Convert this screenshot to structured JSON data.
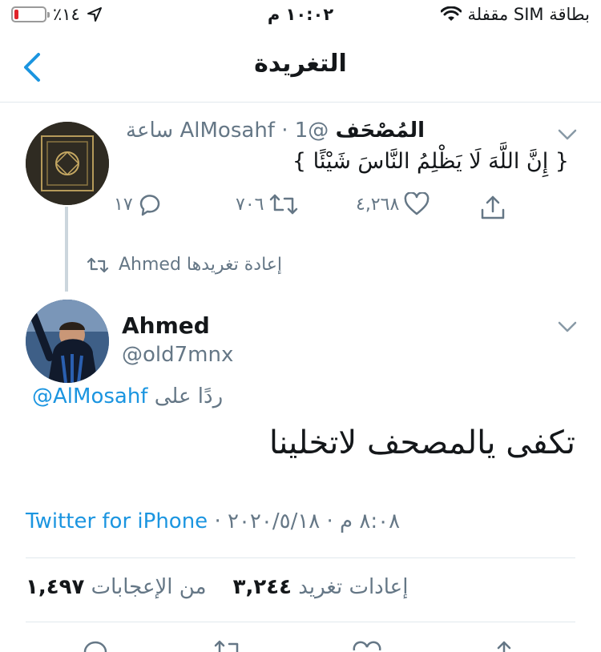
{
  "status_bar": {
    "carrier": "بطاقة SIM مقفلة",
    "time": "١٠:٠٢ م",
    "battery": "٪١٤",
    "battery_level": 0.14
  },
  "nav": {
    "title": "التغريدة"
  },
  "tweet1": {
    "name": "المُصْحَف",
    "handle": "@AlMosahf",
    "time": "· 1 ساعة",
    "text": "{ إِنَّ اللَّهَ لَا يَظْلِمُ النَّاسَ شَيْئًا }",
    "replies": "١٧",
    "retweets": "٧٠٦",
    "likes": "٤,٢٦٨"
  },
  "retweeted_by": "Ahmed إعادة تغريدها",
  "main_tweet": {
    "name": "Ahmed",
    "handle": "@old7mnx",
    "reply_label": "ردًا على",
    "reply_handle": "@AlMosahf",
    "text": "تكفى يالمصحف لاتخلينا",
    "timestamp": "٨:٠٨ م · ٢٠٢٠/٥/١٨ ·",
    "source": "Twitter for iPhone",
    "likes_count": "١,٤٩٧",
    "likes_label": "من الإعجابات",
    "retweets_count": "٣,٢٤٤",
    "retweets_label": "إعادات تغريد"
  },
  "colors": {
    "accent": "#1b95e0",
    "secondary_text": "#657786",
    "divider": "#e1e8ed",
    "battery_low": "#e0242b"
  }
}
